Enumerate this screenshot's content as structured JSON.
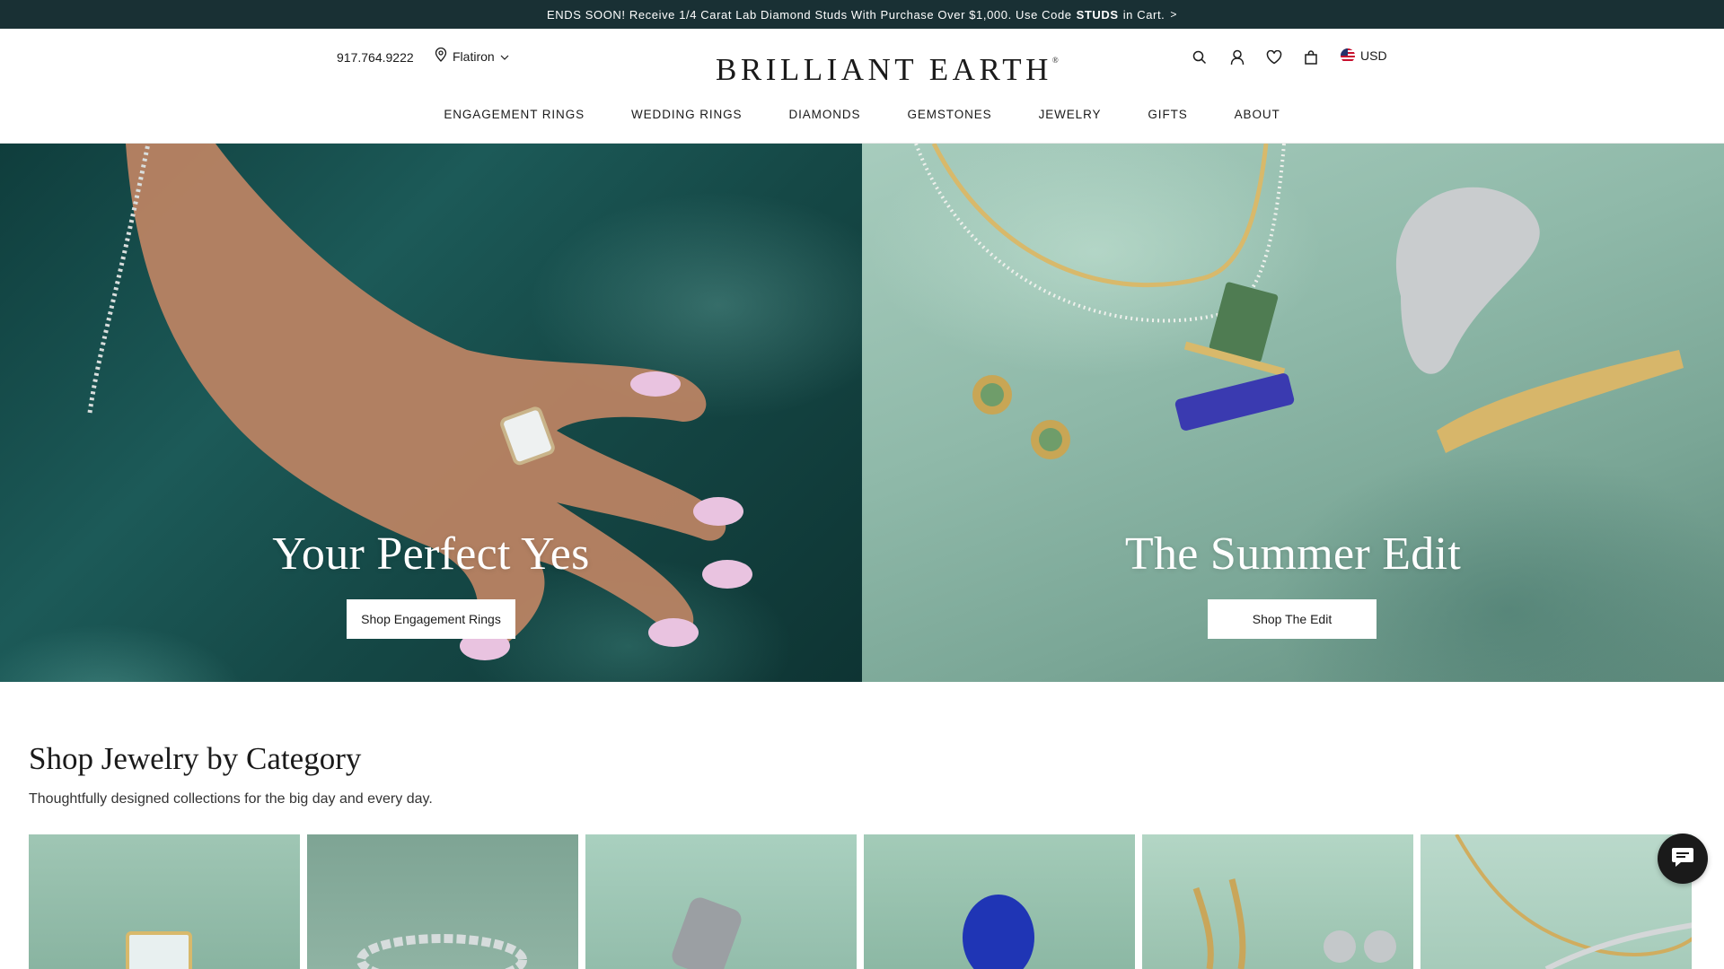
{
  "promo": {
    "text_before": "ENDS SOON! Receive 1/4 Carat Lab Diamond Studs With Purchase Over $1,000. Use Code",
    "code": "STUDS",
    "text_after": "in Cart.",
    "arrow": ">"
  },
  "header": {
    "phone": "917.764.9222",
    "location": "Flatiron",
    "logo": "BRILLIANT EARTH",
    "logo_mark": "®",
    "currency": "USD"
  },
  "nav": [
    "ENGAGEMENT RINGS",
    "WEDDING RINGS",
    "DIAMONDS",
    "GEMSTONES",
    "JEWELRY",
    "GIFTS",
    "ABOUT"
  ],
  "hero": {
    "left": {
      "title": "Your Perfect Yes",
      "button": "Shop Engagement Rings"
    },
    "right": {
      "title": "The Summer Edit",
      "button": "Shop The Edit"
    }
  },
  "categories": {
    "title": "Shop Jewelry by Category",
    "subtitle": "Thoughtfully designed collections for the big day and every day."
  },
  "icons": {
    "search": "search-icon",
    "account": "user-icon",
    "wishlist": "heart-icon",
    "cart": "bag-icon",
    "location": "map-pin-icon",
    "chat": "chat-icon"
  },
  "colors": {
    "promo_bg": "#193034",
    "text": "#1a1a1a",
    "button_bg": "#ffffff",
    "chat_bg": "#1a1a1a"
  }
}
